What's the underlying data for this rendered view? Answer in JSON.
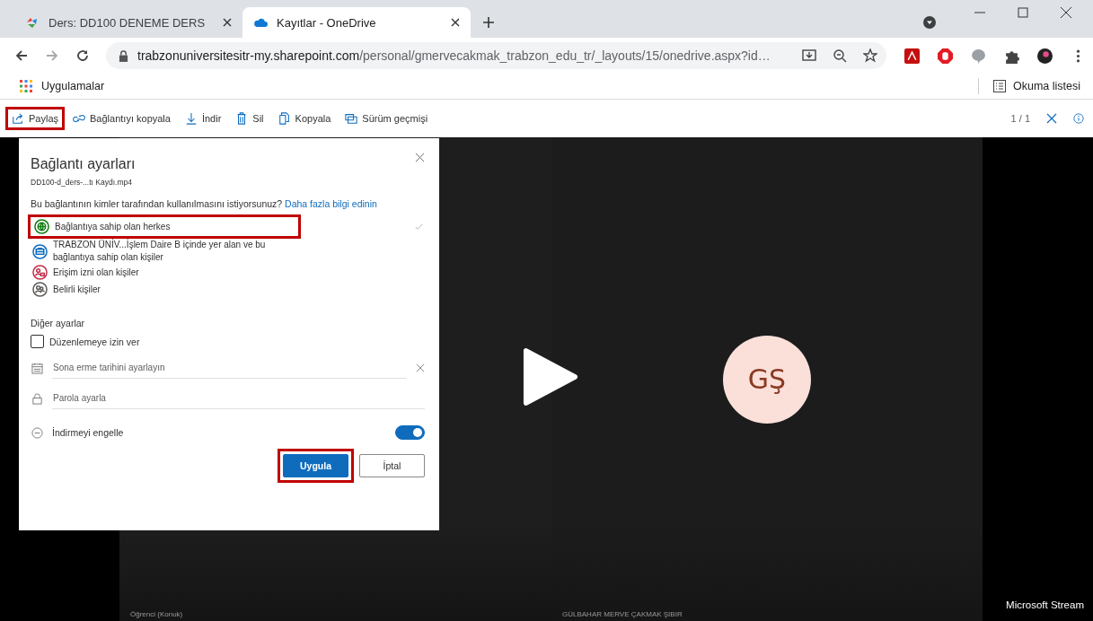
{
  "browser": {
    "tabs": [
      {
        "title": "Ders: DD100 DENEME DERS",
        "kind": "moodle",
        "selected": false
      },
      {
        "title": "Kayıtlar - OneDrive",
        "kind": "cloud",
        "selected": true
      }
    ],
    "url": {
      "host": "trabzonuniversitesitr-my.sharepoint.com",
      "path": "/personal/gmervecakmak_trabzon_edu_tr/_layouts/15/onedrive.aspx?id…"
    },
    "bookmarks": [
      {
        "label": "Uygulamalar"
      }
    ],
    "reading_list": "Okuma listesi"
  },
  "toolbar": {
    "actions": [
      {
        "label": "Paylaş",
        "kind": "share",
        "highlighted": true
      },
      {
        "label": "Bağlantıyı kopyala",
        "kind": "link",
        "highlighted": false
      },
      {
        "label": "İndir",
        "kind": "download",
        "highlighted": false
      },
      {
        "label": "Sil",
        "kind": "delete",
        "highlighted": false
      },
      {
        "label": "Kopyala",
        "kind": "copy",
        "highlighted": false
      },
      {
        "label": "Sürüm geçmişi",
        "kind": "history",
        "highlighted": false
      }
    ],
    "counter": "1 / 1"
  },
  "dialog": {
    "title": "Bağlantı ayarları",
    "filename": "DD100-d_ders-...tı Kaydı.mp4",
    "question": "Bu bağlantının kimler tarafından kullanılmasını istiyorsunuz?",
    "learn_more": "Daha fazla bilgi edinin",
    "options": [
      {
        "label": "Bağlantıya sahip olan herkes",
        "kind": "globe",
        "color": "#107c10",
        "selected": true,
        "highlighted": true
      },
      {
        "label": "TRABZON ÜNİV...İşlem Daire B içinde yer alan ve bu bağlantıya sahip olan kişiler",
        "kind": "org",
        "color": "#0f6cbd",
        "selected": false,
        "highlighted": false
      },
      {
        "label": "Erişim izni olan kişiler",
        "kind": "lock",
        "color": "#c4314b",
        "selected": false,
        "highlighted": false
      },
      {
        "label": "Belirli kişiler",
        "kind": "people",
        "color": "#605e5c",
        "selected": false,
        "highlighted": false
      }
    ],
    "other_heading": "Diğer ayarlar",
    "allow_edit": {
      "label": "Düzenlemeye izin ver",
      "checked": false
    },
    "expiry": {
      "placeholder": "Sona erme tarihini ayarlayın"
    },
    "password": {
      "placeholder": "Parola ayarla"
    },
    "block_download": {
      "label": "İndirmeyi engelle",
      "on": true
    },
    "buttons": [
      {
        "label": "Uygula",
        "kind": "primary",
        "highlighted": true
      },
      {
        "label": "İptal",
        "kind": "secondary",
        "highlighted": false
      }
    ]
  },
  "video": {
    "avatar": "GŞ",
    "captions": [
      "Öğrenci (Konuk)",
      "GÜLBAHAR MERVE ÇAKMAK ŞIBIR"
    ],
    "brand": "Microsoft Stream"
  }
}
